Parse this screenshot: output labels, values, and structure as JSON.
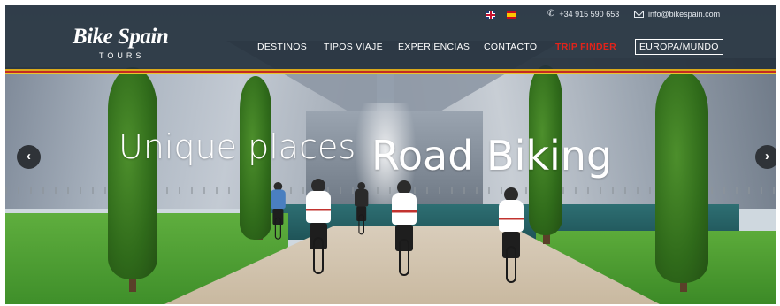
{
  "header": {
    "languages": [
      {
        "name": "english",
        "icon": "uk-flag-icon"
      },
      {
        "name": "spanish",
        "icon": "spain-flag-icon"
      }
    ],
    "phone": "+34 915 590 653",
    "email": "info@bikespain.com",
    "logo": {
      "main": "Bike Spain",
      "sub": "TOURS"
    }
  },
  "nav": {
    "destinos": "DESTINOS",
    "tipos_viaje": "TIPOS VIAJE",
    "experiencias": "EXPERIENCIAS",
    "contacto": "CONTACTO",
    "trip_finder": "TRIP FINDER",
    "europa_mundo": "EUROPA/MUNDO"
  },
  "slider": {
    "captions": [
      "Unique places",
      "Road Biking"
    ],
    "prev_icon": "‹",
    "next_icon": "›"
  },
  "colors": {
    "header_bg": "#26323d",
    "trip_finder": "#e2231a",
    "stripe_yellow": "#d9a91b",
    "stripe_red": "#c52b22"
  }
}
